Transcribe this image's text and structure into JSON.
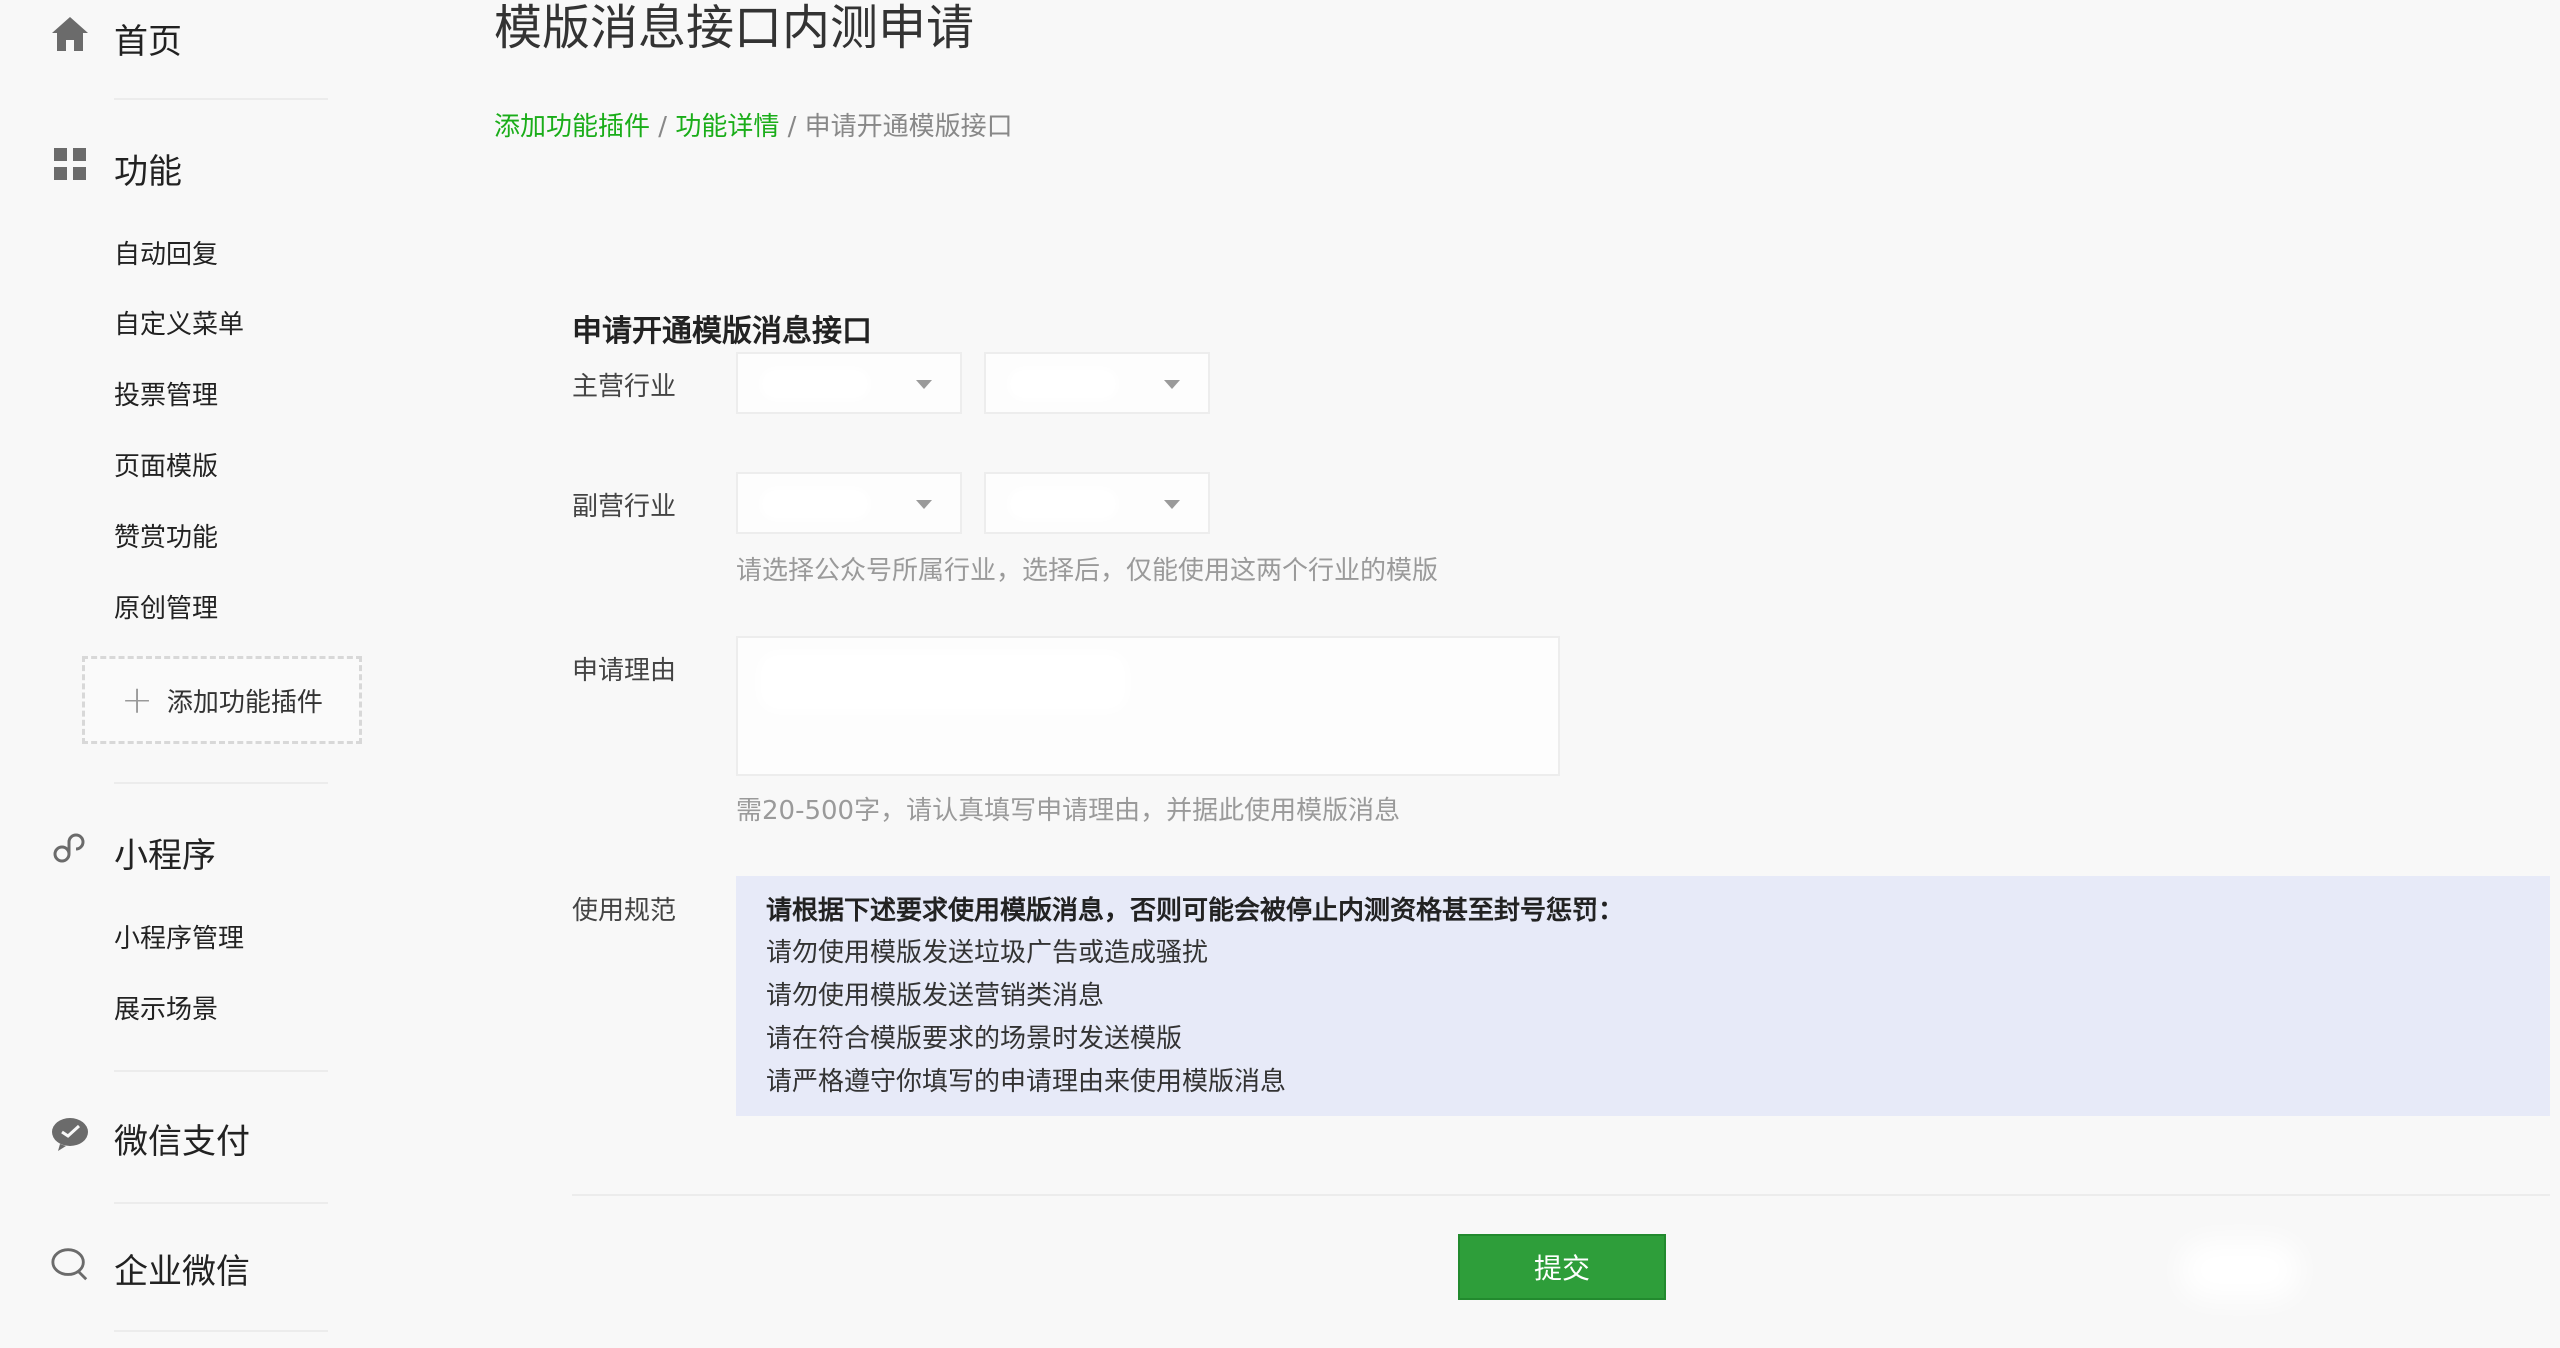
{
  "sidebar": {
    "home_label": "首页",
    "functions": {
      "label": "功能",
      "items": [
        {
          "label": "自动回复"
        },
        {
          "label": "自定义菜单"
        },
        {
          "label": "投票管理"
        },
        {
          "label": "页面模版"
        },
        {
          "label": "赞赏功能"
        },
        {
          "label": "原创管理"
        }
      ],
      "add_plugin_label": "添加功能插件"
    },
    "mini_program": {
      "label": "小程序",
      "items": [
        {
          "label": "小程序管理"
        },
        {
          "label": "展示场景"
        }
      ]
    },
    "wechat_pay_label": "微信支付",
    "wecom_label": "企业微信"
  },
  "main": {
    "title": "模版消息接口内测申请",
    "breadcrumb": {
      "items": [
        "添加功能插件",
        "功能详情",
        "申请开通模版接口"
      ],
      "separator": "/"
    },
    "section_title": "申请开通模版消息接口",
    "form": {
      "primary_industry_label": "主营行业",
      "secondary_industry_label": "副营行业",
      "industry_hint": "请选择公众号所属行业，选择后，仅能使用这两个行业的模版",
      "reason_label": "申请理由",
      "reason_hint": "需20-500字，请认真填写申请理由，并据此使用模版消息",
      "rules_label": "使用规范",
      "rules_title": "请根据下述要求使用模版消息，否则可能会被停止内测资格甚至封号惩罚：",
      "rules": [
        "请勿使用模版发送垃圾广告或造成骚扰",
        "请勿使用模版发送营销类消息",
        "请在符合模版要求的场景时发送模版",
        "请严格遵守你填写的申请理由来使用模版消息"
      ]
    },
    "submit_label": "提交"
  },
  "colors": {
    "accent_green": "#1aad19",
    "button_green": "#2e9e3a",
    "rules_bg": "#e7eaf8"
  }
}
